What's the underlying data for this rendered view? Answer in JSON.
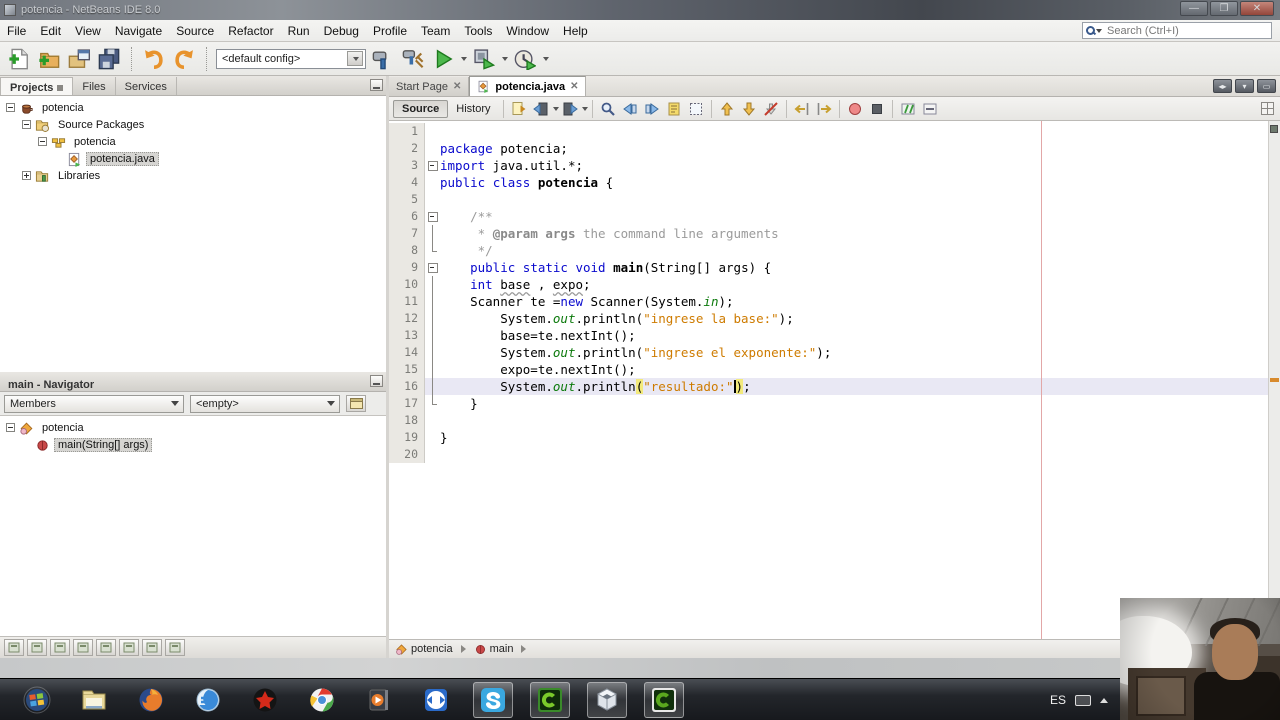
{
  "title_bar": {
    "title": "potencia - NetBeans IDE 8.0",
    "buttons": {
      "minimize": "—",
      "restore": "❐",
      "close": "✕"
    }
  },
  "menu_bar": {
    "items": [
      "File",
      "Edit",
      "View",
      "Navigate",
      "Source",
      "Refactor",
      "Run",
      "Debug",
      "Profile",
      "Team",
      "Tools",
      "Window",
      "Help"
    ],
    "search_placeholder": "Search (Ctrl+I)"
  },
  "toolbar": {
    "config_value": "<default config>",
    "groups": [
      [
        "new-file",
        "new-project",
        "open-project",
        "save-all"
      ],
      [
        "undo",
        "redo"
      ],
      [
        "build",
        "clean-build",
        "run",
        "debug",
        "profile"
      ]
    ],
    "dropdown_icons": [
      "run",
      "debug",
      "profile"
    ]
  },
  "projects_panel": {
    "tabs": [
      {
        "label": "Projects",
        "active": true
      },
      {
        "label": "Files",
        "active": false
      },
      {
        "label": "Services",
        "active": false
      }
    ],
    "tree": [
      {
        "depth": 0,
        "expander": "minus",
        "icon": "project",
        "label": "potencia",
        "selected": false
      },
      {
        "depth": 1,
        "expander": "minus",
        "icon": "srcpkg",
        "label": "Source Packages",
        "selected": false
      },
      {
        "depth": 2,
        "expander": "minus",
        "icon": "package",
        "label": "potencia",
        "selected": false
      },
      {
        "depth": 3,
        "expander": "none",
        "icon": "javafile",
        "label": "potencia.java",
        "selected": true
      },
      {
        "depth": 1,
        "expander": "plus",
        "icon": "libraries",
        "label": "Libraries",
        "selected": false
      }
    ]
  },
  "navigator_panel": {
    "title": "main - Navigator",
    "members_filter": "Members",
    "inherited_filter": "<empty>",
    "tree": [
      {
        "depth": 0,
        "expander": "minus",
        "icon": "class",
        "label": "potencia",
        "selected": false
      },
      {
        "depth": 1,
        "expander": "none",
        "icon": "method",
        "label": "main(String[] args)",
        "selected": true
      }
    ],
    "filter_icons": [
      "show-inherited",
      "show-fields",
      "show-static",
      "show-public",
      "show-non-public",
      "sort-alphabetically",
      "sort-by-source",
      "expand-all"
    ]
  },
  "editor": {
    "tabs": [
      {
        "label": "Start Page",
        "active": false,
        "icon": "none"
      },
      {
        "label": "potencia.java",
        "active": true,
        "icon": "javafile"
      }
    ],
    "toolbar": {
      "source_label": "Source",
      "history_label": "History",
      "groups": [
        [
          "last-edit",
          "back",
          "forward"
        ],
        [
          "find-selection",
          "find-prev",
          "find-next",
          "toggle-highlight",
          "rect-selection"
        ],
        [
          "prev-occurrence",
          "next-occurrence",
          "clear-occurrences"
        ],
        [
          "shift-left",
          "shift-right"
        ],
        [
          "record-macro",
          "stop-macro"
        ],
        [
          "comment",
          "uncomment"
        ]
      ]
    },
    "breadcrumb": [
      {
        "icon": "class",
        "label": "potencia"
      },
      {
        "icon": "method",
        "label": "main"
      }
    ],
    "code": {
      "language": "java",
      "current_line": 16,
      "lines": [
        {
          "n": 1,
          "fold": "",
          "tokens": []
        },
        {
          "n": 2,
          "fold": "",
          "tokens": [
            [
              "kw",
              "package"
            ],
            [
              "pl",
              " potencia;"
            ]
          ]
        },
        {
          "n": 3,
          "fold": "minus",
          "tokens": [
            [
              "kw",
              "import"
            ],
            [
              "pl",
              " java.util.*;"
            ]
          ]
        },
        {
          "n": 4,
          "fold": "",
          "tokens": [
            [
              "kw",
              "public"
            ],
            [
              "pl",
              " "
            ],
            [
              "kw",
              "class"
            ],
            [
              "pl",
              " "
            ],
            [
              "bold",
              "potencia"
            ],
            [
              "pl",
              " {"
            ]
          ]
        },
        {
          "n": 5,
          "fold": "",
          "tokens": []
        },
        {
          "n": 6,
          "fold": "minus",
          "tokens": [
            [
              "com",
              "    /**"
            ]
          ]
        },
        {
          "n": 7,
          "fold": "line",
          "tokens": [
            [
              "com",
              "     * "
            ],
            [
              "comb",
              "@param args"
            ],
            [
              "com",
              " the command line arguments"
            ]
          ]
        },
        {
          "n": 8,
          "fold": "end",
          "tokens": [
            [
              "com",
              "     */"
            ]
          ]
        },
        {
          "n": 9,
          "fold": "minus",
          "tokens": [
            [
              "pl",
              "    "
            ],
            [
              "kw",
              "public"
            ],
            [
              "pl",
              " "
            ],
            [
              "kw",
              "static"
            ],
            [
              "pl",
              " "
            ],
            [
              "kw",
              "void"
            ],
            [
              "pl",
              " "
            ],
            [
              "bold",
              "main"
            ],
            [
              "pl",
              "(String[] args) {"
            ]
          ]
        },
        {
          "n": 10,
          "fold": "line",
          "tokens": [
            [
              "pl",
              "    "
            ],
            [
              "kw",
              "int"
            ],
            [
              "pl",
              " "
            ],
            [
              "ulw",
              "base"
            ],
            [
              "pl",
              " , "
            ],
            [
              "ulw",
              "expo"
            ],
            [
              "pl",
              ";"
            ]
          ]
        },
        {
          "n": 11,
          "fold": "line",
          "tokens": [
            [
              "pl",
              "    Scanner te ="
            ],
            [
              "kw",
              "new"
            ],
            [
              "pl",
              " Scanner(System."
            ],
            [
              "fld",
              "in"
            ],
            [
              "pl",
              ");"
            ]
          ]
        },
        {
          "n": 12,
          "fold": "line",
          "tokens": [
            [
              "pl",
              "        System."
            ],
            [
              "fld",
              "out"
            ],
            [
              "pl",
              ".println("
            ],
            [
              "str",
              "\"ingrese la base:\""
            ],
            [
              "pl",
              ");"
            ]
          ]
        },
        {
          "n": 13,
          "fold": "line",
          "tokens": [
            [
              "pl",
              "        base=te.nextInt();"
            ]
          ]
        },
        {
          "n": 14,
          "fold": "line",
          "tokens": [
            [
              "pl",
              "        System."
            ],
            [
              "fld",
              "out"
            ],
            [
              "pl",
              ".println("
            ],
            [
              "str",
              "\"ingrese el exponente:\""
            ],
            [
              "pl",
              ");"
            ]
          ]
        },
        {
          "n": 15,
          "fold": "line",
          "tokens": [
            [
              "pl",
              "        expo=te.nextInt();"
            ]
          ]
        },
        {
          "n": 16,
          "fold": "line",
          "tokens": [
            [
              "pl",
              "        System."
            ],
            [
              "fld",
              "out"
            ],
            [
              "pl",
              ".println"
            ],
            [
              "hl",
              "("
            ],
            [
              "str",
              "\"resultado:\""
            ],
            [
              "caret",
              ""
            ],
            [
              "hl",
              ")"
            ],
            [
              "pl",
              ";"
            ]
          ]
        },
        {
          "n": 17,
          "fold": "end",
          "tokens": [
            [
              "pl",
              "    }"
            ]
          ]
        },
        {
          "n": 18,
          "fold": "",
          "tokens": []
        },
        {
          "n": 19,
          "fold": "",
          "tokens": [
            [
              "pl",
              "}"
            ]
          ]
        },
        {
          "n": 20,
          "fold": "",
          "tokens": []
        }
      ]
    }
  },
  "taskbar": {
    "items": [
      {
        "name": "start",
        "active": false
      },
      {
        "name": "explorer",
        "active": false
      },
      {
        "name": "firefox",
        "active": false
      },
      {
        "name": "internet-explorer",
        "active": false
      },
      {
        "name": "media-red",
        "active": false
      },
      {
        "name": "chrome",
        "active": false
      },
      {
        "name": "media-player",
        "active": false
      },
      {
        "name": "teamviewer",
        "active": false
      },
      {
        "name": "skype",
        "active": true
      },
      {
        "name": "camtasia",
        "active": true
      },
      {
        "name": "netbeans",
        "active": true
      },
      {
        "name": "camtasia-2",
        "active": true
      }
    ],
    "tray": {
      "language": "ES"
    }
  },
  "colors": {
    "keyword": "#0a0acd",
    "string": "#ce7b00",
    "comment": "#9b9b9b",
    "field": "#0d7a0d",
    "current_line_bg": "#e9e8f4",
    "match_highlight": "#f3ea7c",
    "margin_line": "#e2a7a7",
    "occurrence_mark": "#d88a2c",
    "run_green": "#3fae3f"
  }
}
